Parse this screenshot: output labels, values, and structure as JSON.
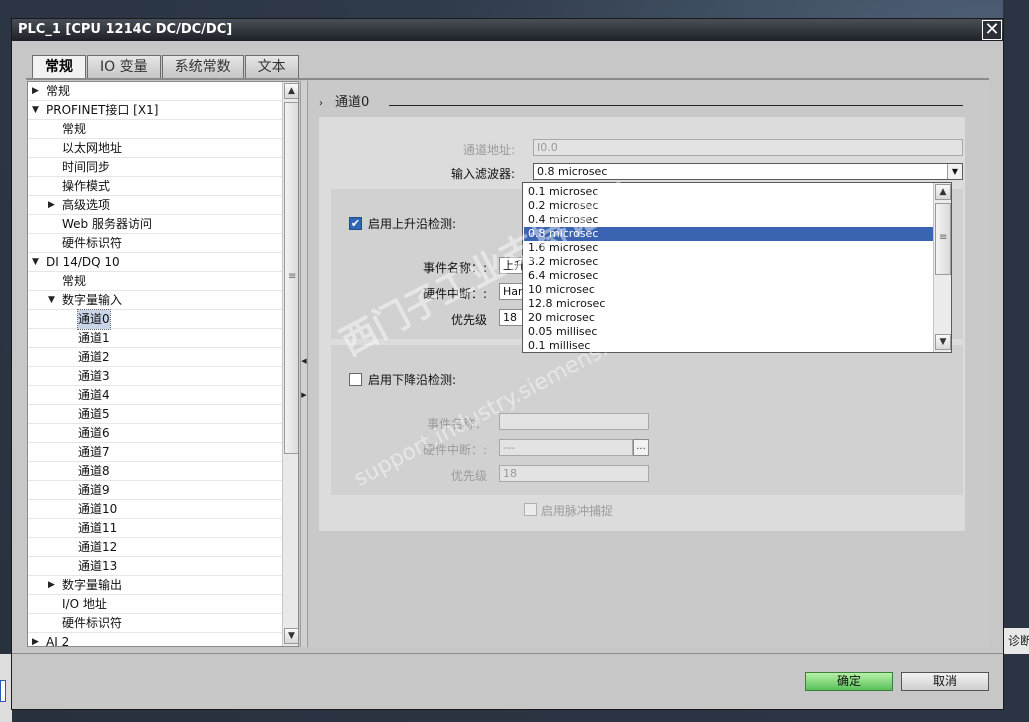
{
  "window": {
    "title": "PLC_1 [CPU 1214C DC/DC/DC]",
    "close_glyph": "✕"
  },
  "tabs": [
    {
      "label": "常规",
      "active": true
    },
    {
      "label": "IO 变量",
      "active": false
    },
    {
      "label": "系统常数",
      "active": false
    },
    {
      "label": "文本",
      "active": false
    }
  ],
  "tree": {
    "items": [
      {
        "label": "常规",
        "arrow": "▶"
      },
      {
        "label": "PROFINET接口 [X1]",
        "arrow": "▼"
      },
      {
        "label": "常规",
        "arrow": ""
      },
      {
        "label": "以太网地址",
        "arrow": ""
      },
      {
        "label": "时间同步",
        "arrow": ""
      },
      {
        "label": "操作模式",
        "arrow": ""
      },
      {
        "label": "高级选项",
        "arrow": "▶"
      },
      {
        "label": "Web 服务器访问",
        "arrow": ""
      },
      {
        "label": "硬件标识符",
        "arrow": ""
      },
      {
        "label": "DI 14/DQ 10",
        "arrow": "▼"
      },
      {
        "label": "常规",
        "arrow": ""
      },
      {
        "label": "数字量输入",
        "arrow": "▼"
      },
      {
        "label": "通道0",
        "arrow": ""
      },
      {
        "label": "通道1",
        "arrow": ""
      },
      {
        "label": "通道2",
        "arrow": ""
      },
      {
        "label": "通道3",
        "arrow": ""
      },
      {
        "label": "通道4",
        "arrow": ""
      },
      {
        "label": "通道5",
        "arrow": ""
      },
      {
        "label": "通道6",
        "arrow": ""
      },
      {
        "label": "通道7",
        "arrow": ""
      },
      {
        "label": "通道8",
        "arrow": ""
      },
      {
        "label": "通道9",
        "arrow": ""
      },
      {
        "label": "通道10",
        "arrow": ""
      },
      {
        "label": "通道11",
        "arrow": ""
      },
      {
        "label": "通道12",
        "arrow": ""
      },
      {
        "label": "通道13",
        "arrow": ""
      },
      {
        "label": "数字量输出",
        "arrow": "▶"
      },
      {
        "label": "I/O 地址",
        "arrow": ""
      },
      {
        "label": "硬件标识符",
        "arrow": ""
      },
      {
        "label": "AI 2",
        "arrow": "▶"
      }
    ],
    "selected_label": "通道0"
  },
  "section": {
    "chevron": "›",
    "title": "通道0"
  },
  "form": {
    "channel_address_label": "通道地址:",
    "channel_address_value": "I0.0",
    "input_filter_label": "输入滤波器:",
    "input_filter_value": "0.8 microsec",
    "rising_edge": {
      "label": "启用上升沿检测:",
      "checked": true,
      "event_name_label": "事件名称：:",
      "event_name_value": "上升",
      "hw_interrupt_label": "硬件中断：:",
      "hw_interrupt_value": "Har",
      "priority_label": "优先级",
      "priority_value": "18"
    },
    "falling_edge": {
      "label": "启用下降沿检测:",
      "checked": false,
      "event_name_label": "事件名称：",
      "event_name_value": "",
      "hw_interrupt_label": "硬件中断：:",
      "hw_interrupt_value": "---",
      "priority_label": "优先级",
      "priority_value": "18"
    },
    "pulse_catch_label": "启用脉冲捕捉"
  },
  "dropdown": {
    "options": [
      "0.1 microsec",
      "0.2 microsec",
      "0.4 microsec",
      "0.8 microsec",
      "1.6 microsec",
      "3.2 microsec",
      "6.4 microsec",
      "10 microsec",
      "12.8 microsec",
      "20 microsec",
      "0.05 millisec",
      "0.1 millisec"
    ],
    "selected": "0.8 microsec"
  },
  "watermark": {
    "line1": "西门子工业支持论坛",
    "line2": "support.industry.siemens.com/cs"
  },
  "footer": {
    "ok_label": "确定",
    "cancel_label": "取消"
  },
  "background": {
    "diag_text": "诊断"
  },
  "colors": {
    "selection": "#3a63b2",
    "ok_button": "#58c15a",
    "titlebar": "#1d2026"
  }
}
